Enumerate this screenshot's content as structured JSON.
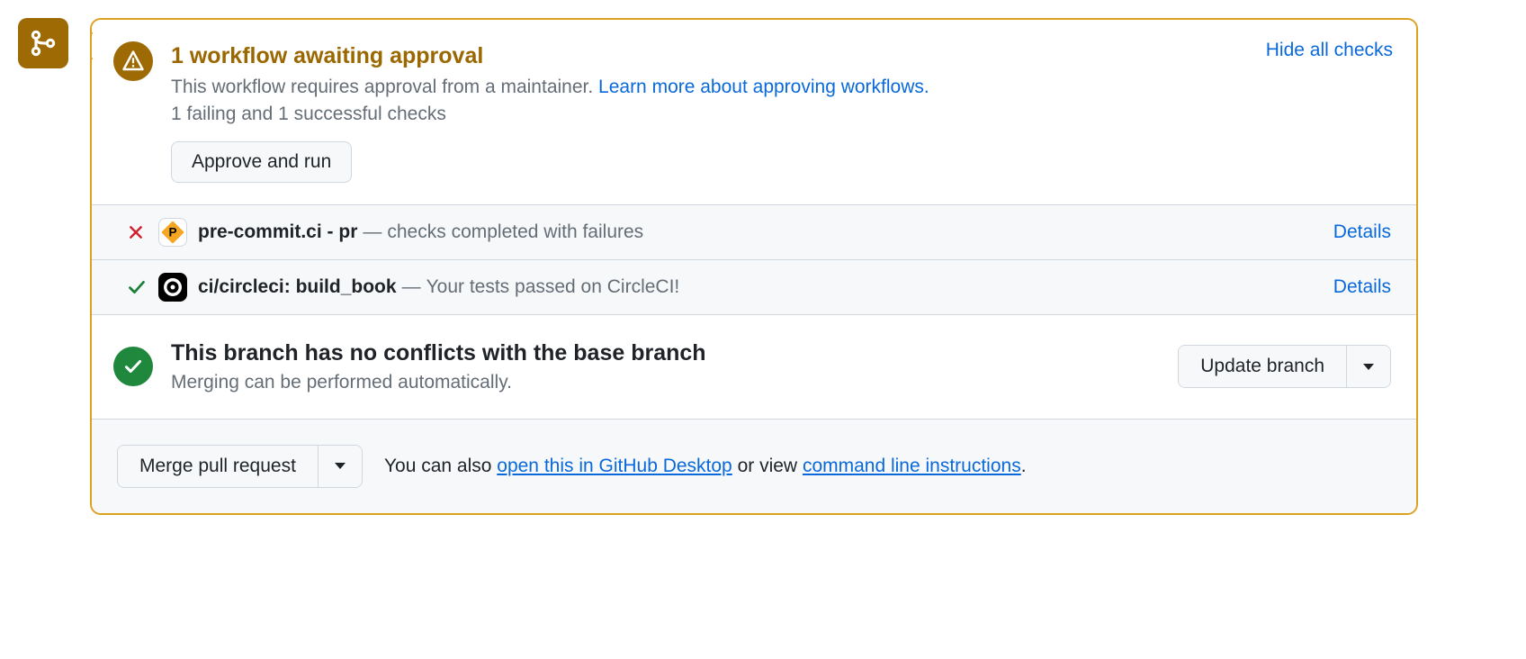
{
  "approval": {
    "title": "1 workflow awaiting approval",
    "desc_prefix": "This workflow requires approval from a maintainer. ",
    "learn_more": "Learn more about approving workflows.",
    "summary": "1 failing and 1 successful checks",
    "approve_btn": "Approve and run",
    "hide_checks": "Hide all checks"
  },
  "checks": [
    {
      "status": "fail",
      "name": "pre-commit.ci - pr",
      "desc": "checks completed with failures",
      "details": "Details"
    },
    {
      "status": "pass",
      "name": "ci/circleci: build_book",
      "desc": "Your tests passed on CircleCI!",
      "details": "Details"
    }
  ],
  "conflicts": {
    "title": "This branch has no conflicts with the base branch",
    "desc": "Merging can be performed automatically.",
    "update_btn": "Update branch"
  },
  "merge": {
    "btn": "Merge pull request",
    "hint_prefix": "You can also ",
    "desktop_link": "open this in GitHub Desktop",
    "hint_mid": " or view ",
    "cli_link": "command line instructions",
    "hint_suffix": "."
  }
}
